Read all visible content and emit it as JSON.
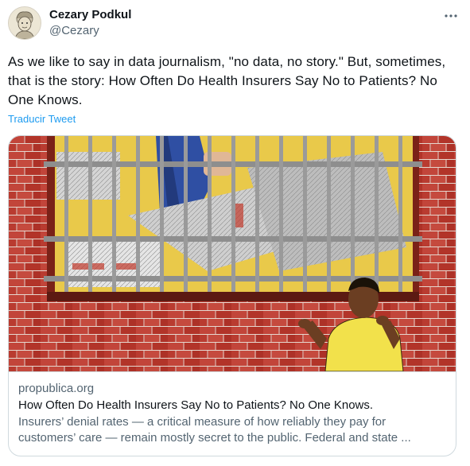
{
  "author": {
    "display_name": "Cezary Podkul",
    "handle": "@Cezary",
    "avatar_icon": "sketch-portrait-avatar"
  },
  "menu_icon": "more-horizontal-icon",
  "tweet": {
    "text": "As we like to say in data journalism, \"no data, no story.\" But, sometimes, that is the story: How Often Do Health Insurers Say No to Patients? No One Knows.",
    "translate_label": "Traducir Tweet"
  },
  "card": {
    "image_description_icon": "illustration-boy-at-barred-window",
    "domain": "propublica.org",
    "title": "How Often Do Health Insurers Say No to Patients? No One Knows.",
    "description_line1": "Insurers’ denial rates — a critical measure of how reliably they pay for",
    "description_line2": "customers’ care — remain mostly secret to the public. Federal and state ..."
  },
  "colors": {
    "link": "#1d9bf0",
    "secondary_text": "#536471",
    "border": "#cfd9de",
    "brick": "#b7352b",
    "shirt": "#f2e14b"
  }
}
